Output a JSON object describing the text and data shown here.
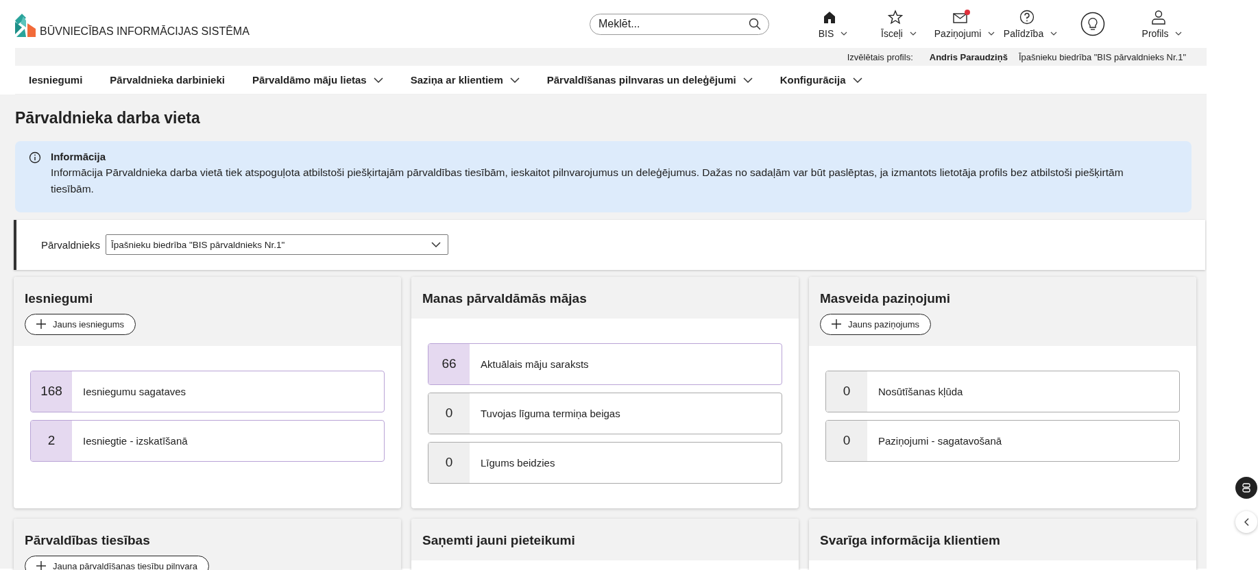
{
  "header": {
    "logo_text": "BŪVNIECĪBAS INFORMĀCIJAS SISTĒMA",
    "search": {
      "placeholder": "Meklēt..."
    },
    "tools": [
      {
        "kind": "home",
        "label": "BIS",
        "badge": false
      },
      {
        "kind": "star",
        "label": "Īsceļi",
        "badge": false
      },
      {
        "kind": "mail",
        "label": "Paziņojumi",
        "badge": true
      },
      {
        "kind": "help",
        "label": "Palīdzība",
        "badge": false
      },
      {
        "kind": "bulb",
        "badge": false
      },
      {
        "kind": "user",
        "label": "Profils",
        "badge": false
      }
    ]
  },
  "profile_bar": {
    "label": "Izvēlētais profils:",
    "name": "Andris Paraudziņš",
    "organization": "Īpašnieku biedrība \"BIS pārvaldnieks Nr.1\""
  },
  "nav": [
    {
      "label": "Iesniegumi",
      "dropdown": false
    },
    {
      "label": "Pārvaldnieka darbinieki",
      "dropdown": false
    },
    {
      "label": "Pārvaldāmo māju lietas",
      "dropdown": true
    },
    {
      "label": "Saziņa ar klientiem",
      "dropdown": true
    },
    {
      "label": "Pārvaldīšanas pilnvaras un deleģējumi",
      "dropdown": true
    },
    {
      "label": "Konfigurācija",
      "dropdown": true
    }
  ],
  "page_title": "Pārvaldnieka darba vieta",
  "info": {
    "title": "Informācija",
    "text": "Informācija Pārvaldnieka darba vietā tiek atspoguļota atbilstoši piešķirtajām pārvaldības tiesībām, ieskaitot pilnvarojumus un deleģējumus. Dažas no sadaļām var būt paslēptas, ja izmantots lietotāja profils bez atbilstoši piešķirtām tiesībām."
  },
  "manager_select": {
    "label": "Pārvaldnieks",
    "value": "Īpašnieku biedrība \"BIS pārvaldnieks Nr.1\""
  },
  "cards": [
    {
      "title": "Iesniegumi",
      "button": "Jauns iesniegums",
      "items": [
        {
          "count": "168",
          "label": "Iesniegumu sagataves",
          "highlighted": true
        },
        {
          "count": "2",
          "label": "Iesniegtie - izskatīšanā",
          "highlighted": true
        }
      ]
    },
    {
      "title": "Manas pārvaldāmās mājas",
      "items": [
        {
          "count": "66",
          "label": "Aktuālais māju saraksts",
          "highlighted": true
        },
        {
          "count": "0",
          "label": "Tuvojas līguma termiņa beigas",
          "highlighted": false
        },
        {
          "count": "0",
          "label": "Līgums beidzies",
          "highlighted": false
        }
      ]
    },
    {
      "title": "Masveida paziņojumi",
      "button": "Jauns paziņojums",
      "items": [
        {
          "count": "0",
          "label": "Nosūtīšanas kļūda",
          "highlighted": false
        },
        {
          "count": "0",
          "label": "Paziņojumi - sagatavošanā",
          "highlighted": false
        }
      ]
    },
    {
      "title": "Pārvaldības tiesības",
      "button": "Jauna pārvaldīšanas tiesību pilnvara"
    },
    {
      "title": "Saņemti jauni pieteikumi"
    },
    {
      "title": "Svarīga informācija klientiem"
    }
  ]
}
